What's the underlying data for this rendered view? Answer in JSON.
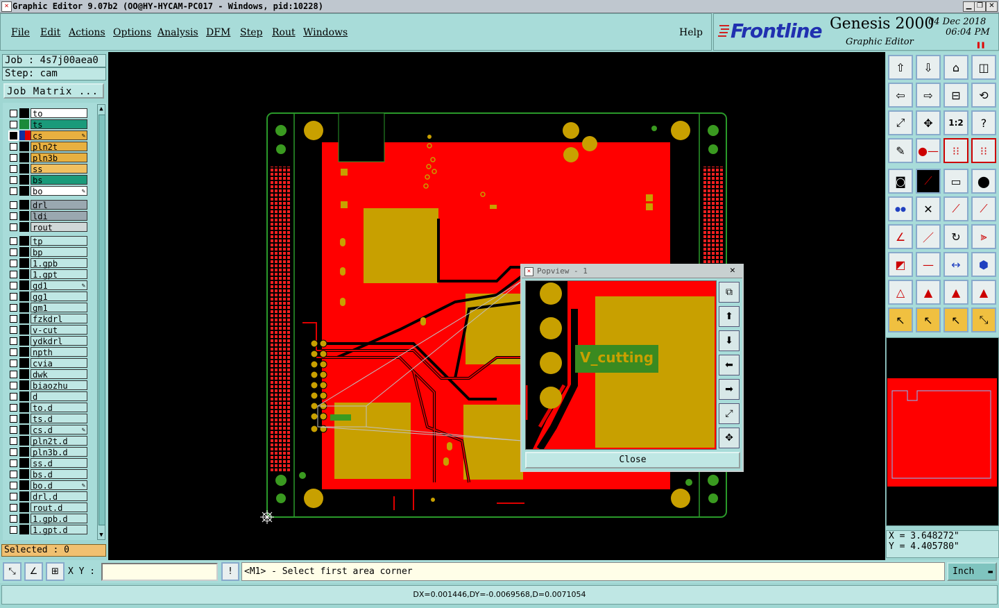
{
  "window": {
    "title": "Graphic Editor 9.07b2  (OO@HY-HYCAM-PC017 - Windows, pid:10228)"
  },
  "menu": {
    "items": [
      "File",
      "Edit",
      "Actions",
      "Options",
      "Analysis",
      "DFM",
      "Step",
      "Rout",
      "Windows"
    ],
    "help": "Help"
  },
  "brand": {
    "logo": "Frontline",
    "product": "Genesis 2000",
    "subtitle": "Graphic Editor",
    "date": "04 Dec 2018",
    "time": "06:04 PM"
  },
  "job": {
    "job_label": "Job : 4s7j00aea0",
    "step_label": "Step: cam",
    "matrix_button": "Job Matrix ..."
  },
  "layers": {
    "group1": [
      {
        "name": "to",
        "swatch": "#000000",
        "bg": "#ffffff",
        "pen": false,
        "selected": false
      },
      {
        "name": "ts",
        "swatch": "#1a8a3a",
        "bg": "#1a9a7a",
        "pen": false,
        "selected": false
      },
      {
        "name": "cs",
        "swatch": "#e00000",
        "bg": "#e8b040",
        "pen": true,
        "selected": true
      },
      {
        "name": "pln2t",
        "swatch": "#000000",
        "bg": "#e8b040",
        "pen": false,
        "selected": false
      },
      {
        "name": "pln3b",
        "swatch": "#000000",
        "bg": "#e8b040",
        "pen": false,
        "selected": false
      },
      {
        "name": "ss",
        "swatch": "#000000",
        "bg": "#f0c060",
        "pen": false,
        "selected": false
      },
      {
        "name": "bs",
        "swatch": "#000000",
        "bg": "#1a9a7a",
        "pen": false,
        "selected": false
      },
      {
        "name": "bo",
        "swatch": "#000000",
        "bg": "#ffffff",
        "pen": true,
        "selected": false
      }
    ],
    "group2": [
      {
        "name": "drl",
        "bg": "#9aa8b0"
      },
      {
        "name": "ldi",
        "bg": "#9aa8b0"
      },
      {
        "name": "rout",
        "bg": "#d0d8d8"
      }
    ],
    "group3": [
      {
        "name": "tp",
        "pen": false
      },
      {
        "name": "bp",
        "pen": false
      },
      {
        "name": "1.gpb",
        "pen": false
      },
      {
        "name": "1.gpt",
        "pen": false
      },
      {
        "name": "gd1",
        "pen": true
      },
      {
        "name": "gg1",
        "pen": false
      },
      {
        "name": "gm1",
        "pen": false
      },
      {
        "name": "fzkdrl",
        "pen": false
      },
      {
        "name": "v-cut",
        "pen": false
      },
      {
        "name": "ydkdrl",
        "pen": false
      },
      {
        "name": "npth",
        "pen": false
      },
      {
        "name": "cvia",
        "pen": false
      },
      {
        "name": "dwk",
        "pen": false
      },
      {
        "name": "biaozhu",
        "pen": false
      },
      {
        "name": "d",
        "pen": false
      },
      {
        "name": "to.d",
        "pen": false
      },
      {
        "name": "ts.d",
        "pen": false
      },
      {
        "name": "cs.d",
        "pen": true
      },
      {
        "name": "pln2t.d",
        "pen": false
      },
      {
        "name": "pln3b.d",
        "pen": false
      },
      {
        "name": "ss.d",
        "pen": false
      },
      {
        "name": "bs.d",
        "pen": false
      },
      {
        "name": "bo.d",
        "pen": true
      },
      {
        "name": "drl.d",
        "pen": false
      },
      {
        "name": "rout.d",
        "pen": false
      },
      {
        "name": "1.gpb.d",
        "pen": false
      },
      {
        "name": "1.gpt.d",
        "pen": false
      }
    ]
  },
  "selected_label": "Selected : 0",
  "popview": {
    "title": "Popview - 1",
    "label_text": "V_cutting",
    "close_button": "Close"
  },
  "coords": {
    "x": "X = 3.648272\"",
    "y": "Y = 4.405780\""
  },
  "statusbar": {
    "xy_label": "X Y :",
    "xy_value": "",
    "prompt": "<M1> - Select first area corner",
    "units": "Inch",
    "measure": "DX=0.001446,DY=-0.0069568,D=0.0071054"
  },
  "colors": {
    "board_red": "#ff0000",
    "pad_gold": "#c8a000",
    "pad_green": "#3a8a20",
    "panel_teal": "#a8dcd9"
  }
}
